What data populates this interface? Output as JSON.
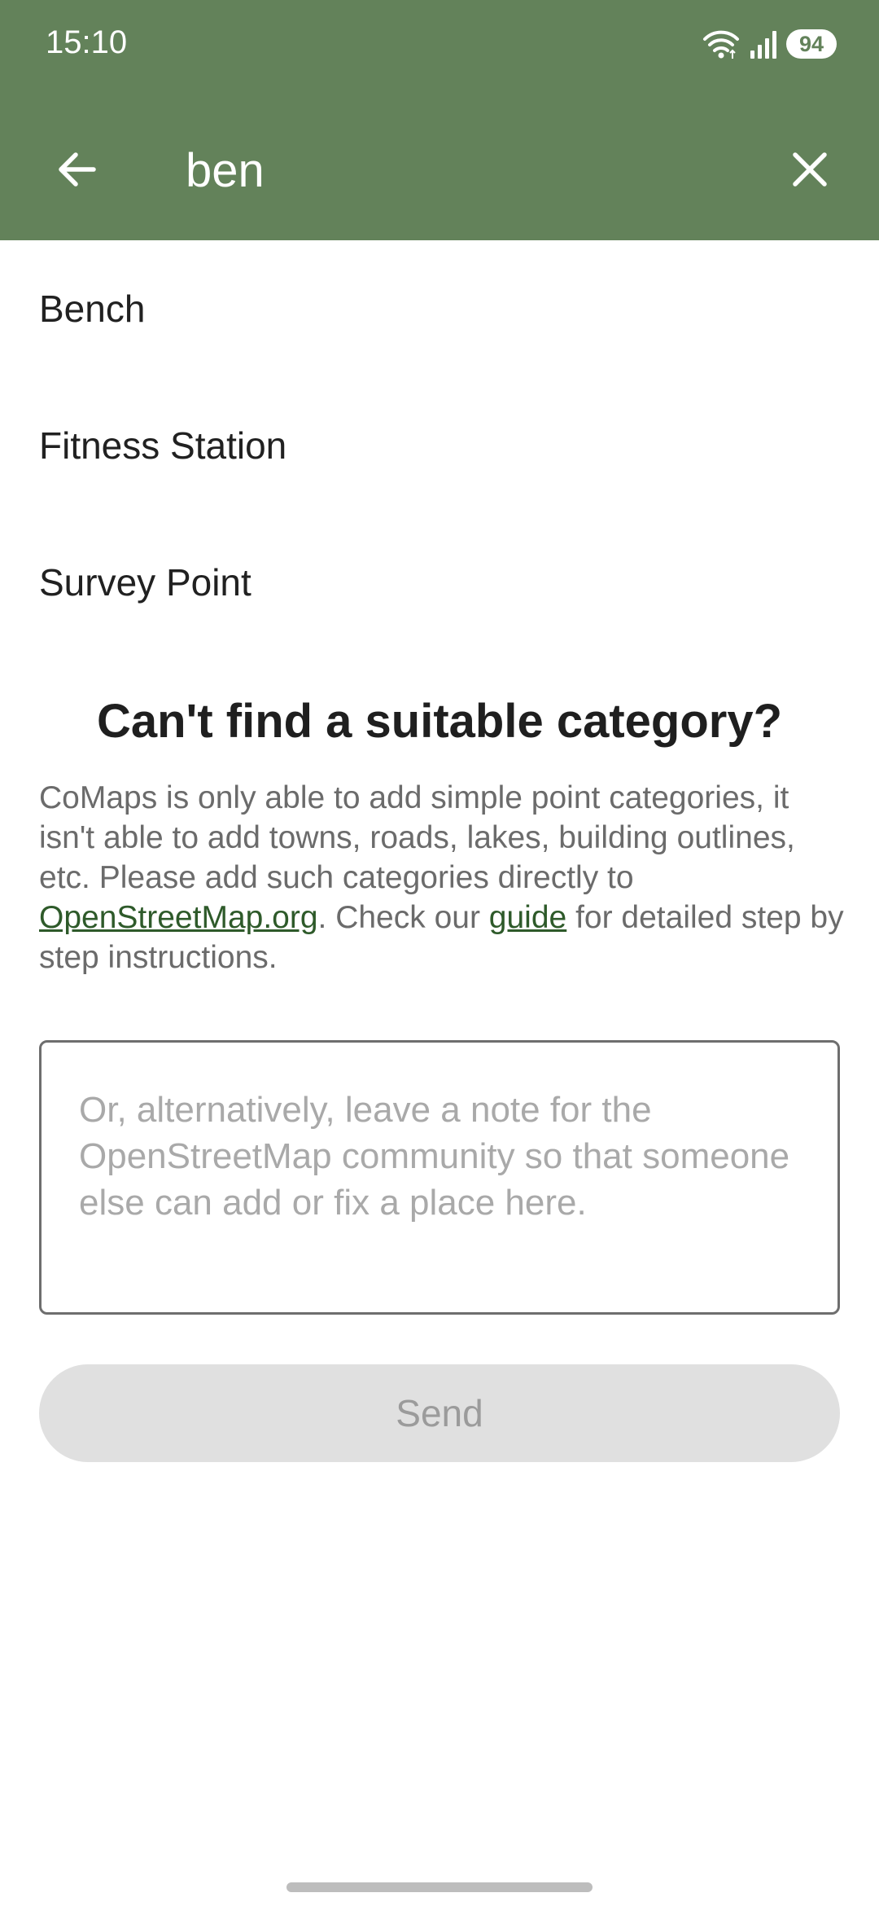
{
  "status_bar": {
    "time": "15:10",
    "battery": "94",
    "icons": [
      "wifi-icon",
      "signal-icon",
      "battery-icon"
    ]
  },
  "toolbar": {
    "search_value": "ben",
    "back_icon": "arrow-left-icon",
    "clear_icon": "close-icon",
    "background_color": "#63825a"
  },
  "results": [
    {
      "label": "Bench"
    },
    {
      "label": "Fitness Station"
    },
    {
      "label": "Survey Point"
    }
  ],
  "help": {
    "title": "Can't find a suitable category?",
    "text_part1": "CoMaps is only able to add simple point categories, it isn't able to add towns, roads, lakes, building outlines, etc. Please add such categories directly to ",
    "link1": "OpenStreetMap.org",
    "text_part2": ". Check our ",
    "link2": "guide",
    "text_part3": " for detailed step by step instructions.",
    "link_color": "#2e5a2a"
  },
  "note": {
    "value": "",
    "placeholder": "Or, alternatively, leave a note for the OpenStreetMap community so that someone else can add or fix a place here."
  },
  "send_button": {
    "label": "Send",
    "enabled": false
  }
}
